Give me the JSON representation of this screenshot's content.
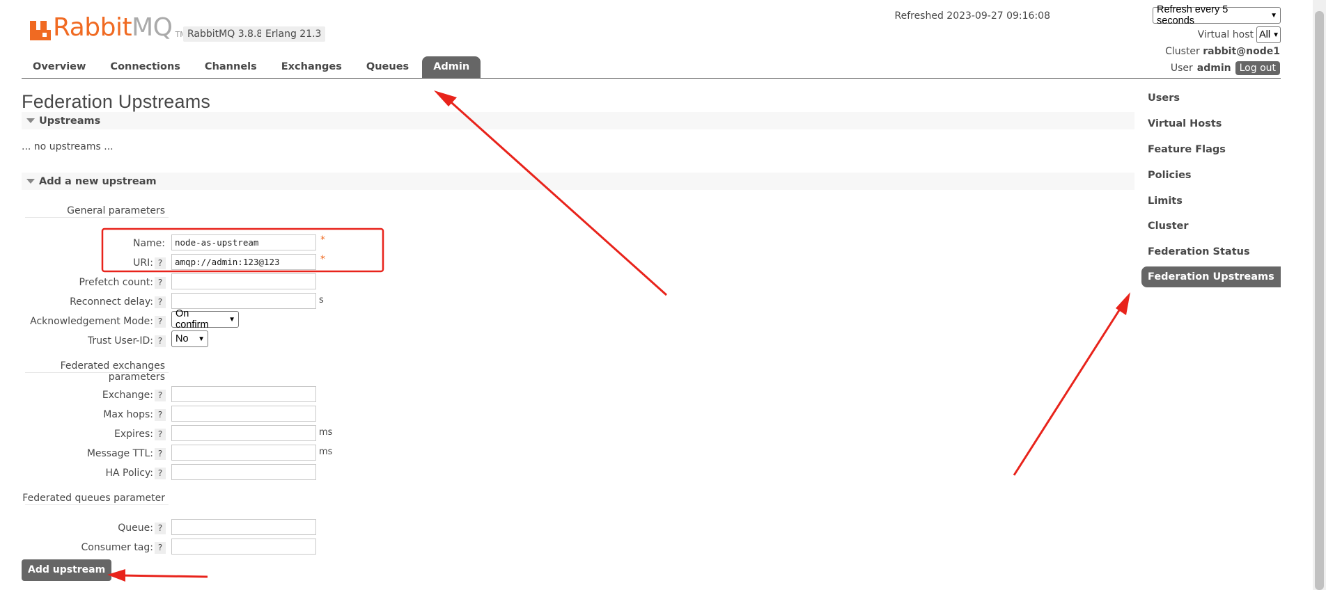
{
  "logo": {
    "brand": "RabbitMQ",
    "brand_main": "Rabbit",
    "brand_accent": "MQ",
    "tm": "TM",
    "brand_color": "#f06a22"
  },
  "versions": {
    "rabbitmq": "RabbitMQ 3.8.8",
    "erlang": "Erlang 21.3"
  },
  "header": {
    "refreshed": "Refreshed 2023-09-27 09:16:08",
    "refresh_option": "Refresh every 5 seconds",
    "vhost_label": "Virtual host",
    "vhost_value": "All",
    "cluster_label": "Cluster",
    "cluster_name": "rabbit@node1",
    "user_label": "User",
    "user_name": "admin",
    "logout": "Log out"
  },
  "tabs": [
    {
      "label": "Overview",
      "active": false
    },
    {
      "label": "Connections",
      "active": false
    },
    {
      "label": "Channels",
      "active": false
    },
    {
      "label": "Exchanges",
      "active": false
    },
    {
      "label": "Queues",
      "active": false
    },
    {
      "label": "Admin",
      "active": true
    }
  ],
  "page": {
    "title": "Federation Upstreams",
    "upstreams_section": "Upstreams",
    "no_upstreams": "... no upstreams ...",
    "add_section": "Add a new upstream"
  },
  "form": {
    "general_heading": "General parameters",
    "name_label": "Name:",
    "name_value": "node-as-upstream",
    "uri_label": "URI:",
    "uri_value": "amqp://admin:123@123",
    "required_mark": "*",
    "help_mark": "?",
    "prefetch_label": "Prefetch count:",
    "reconnect_label": "Reconnect delay:",
    "reconnect_unit": "s",
    "ack_label": "Acknowledgement Mode:",
    "ack_value": "On confirm",
    "trust_label": "Trust User-ID:",
    "trust_value": "No",
    "exchanges_heading": "Federated exchanges parameters",
    "exchange_label": "Exchange:",
    "maxhops_label": "Max hops:",
    "expires_label": "Expires:",
    "expires_unit": "ms",
    "ttl_label": "Message TTL:",
    "ttl_unit": "ms",
    "ha_label": "HA Policy:",
    "queues_heading": "Federated queues parameter",
    "queue_label": "Queue:",
    "consumer_label": "Consumer tag:",
    "submit": "Add upstream"
  },
  "sidebar": {
    "items": [
      {
        "label": "Users",
        "active": false
      },
      {
        "label": "Virtual Hosts",
        "active": false
      },
      {
        "label": "Feature Flags",
        "active": false
      },
      {
        "label": "Policies",
        "active": false
      },
      {
        "label": "Limits",
        "active": false
      },
      {
        "label": "Cluster",
        "active": false
      },
      {
        "label": "Federation Status",
        "active": false
      },
      {
        "label": "Federation Upstreams",
        "active": true
      }
    ]
  },
  "colors": {
    "accent": "#f06a22",
    "tab_active": "#666666",
    "annotation": "#e8231b"
  }
}
